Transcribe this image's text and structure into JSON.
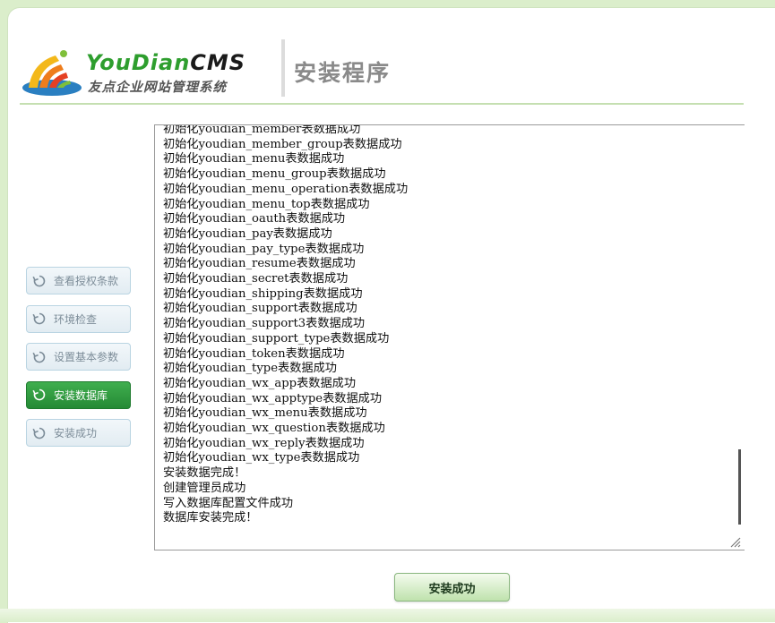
{
  "header": {
    "logo_word_main": "YouDian",
    "logo_word_cms": "CMS",
    "logo_sub": "友点企业网站管理系统",
    "title": "安装程序"
  },
  "steps": [
    {
      "label": "查看授权条款",
      "icon": "refresh-icon",
      "active": false
    },
    {
      "label": "环境检查",
      "icon": "refresh-icon",
      "active": false
    },
    {
      "label": "设置基本参数",
      "icon": "refresh-icon",
      "active": false
    },
    {
      "label": "安装数据库",
      "icon": "refresh-icon",
      "active": true
    },
    {
      "label": "安装成功",
      "icon": "refresh-icon",
      "active": false
    }
  ],
  "log": {
    "lines": [
      "初始化youdian_member表数据成功",
      "初始化youdian_member_group表数据成功",
      "初始化youdian_menu表数据成功",
      "初始化youdian_menu_group表数据成功",
      "初始化youdian_menu_operation表数据成功",
      "初始化youdian_menu_top表数据成功",
      "初始化youdian_oauth表数据成功",
      "初始化youdian_pay表数据成功",
      "初始化youdian_pay_type表数据成功",
      "初始化youdian_resume表数据成功",
      "初始化youdian_secret表数据成功",
      "初始化youdian_shipping表数据成功",
      "初始化youdian_support表数据成功",
      "初始化youdian_support3表数据成功",
      "初始化youdian_support_type表数据成功",
      "初始化youdian_token表数据成功",
      "初始化youdian_type表数据成功",
      "初始化youdian_wx_app表数据成功",
      "初始化youdian_wx_apptype表数据成功",
      "初始化youdian_wx_menu表数据成功",
      "初始化youdian_wx_question表数据成功",
      "初始化youdian_wx_reply表数据成功",
      "初始化youdian_wx_type表数据成功",
      "安装数据完成！",
      "创建管理员成功",
      "写入数据库配置文件成功",
      "数据库安装完成！"
    ]
  },
  "footer": {
    "done_button_label": "安装成功"
  },
  "colors": {
    "page_bg": "#dbeecb",
    "accent_green": "#2e9e2e",
    "active_step": "#2f9b40"
  }
}
